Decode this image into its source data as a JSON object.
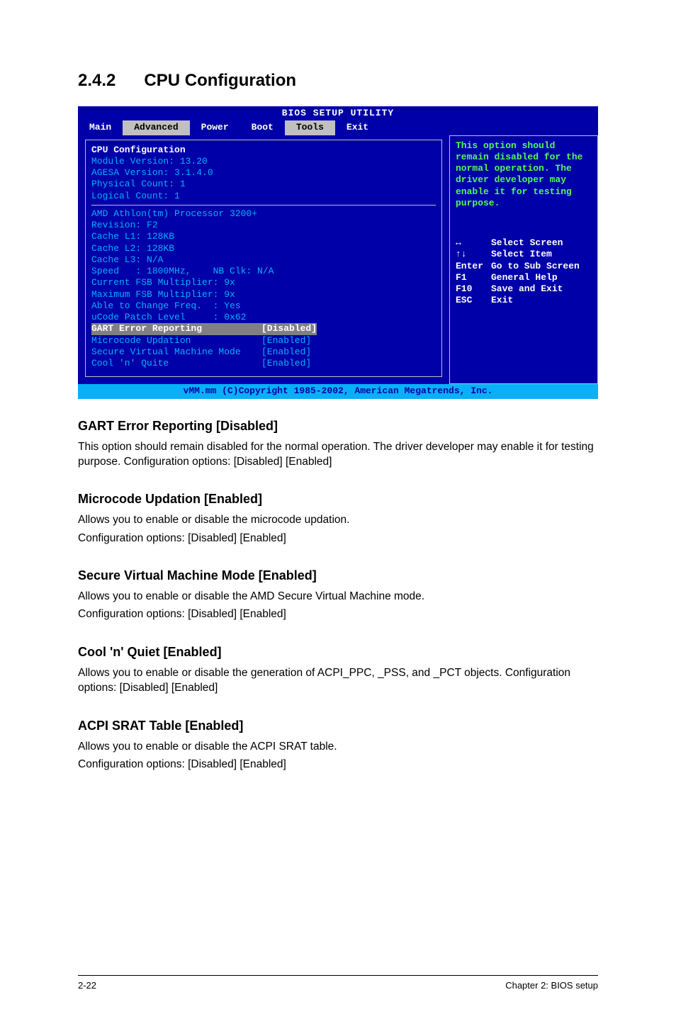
{
  "section": {
    "number": "2.4.2",
    "title": "CPU Configuration"
  },
  "bios": {
    "title": "BIOS SETUP UTILITY",
    "menu": [
      "Main",
      "Advanced",
      "Power",
      "Boot",
      "Tools",
      "Exit"
    ],
    "left": {
      "header": "CPU Configuration",
      "info": [
        "Module Version: 13.20",
        "AGESA Version: 3.1.4.0",
        "Physical Count: 1",
        "Logical Count: 1"
      ],
      "cpu": [
        "AMD Athlon(tm) Processor 3200+",
        "Revision: F2",
        "Cache L1: 128KB",
        "Cache L2: 128KB",
        "Cache L3: N/A",
        "Speed   : 1800MHz,    NB Clk: N/A",
        "Current FSB Multiplier: 9x",
        "Maximum FSB Multiplier: 9x",
        "Able to Change Freq.  : Yes",
        "uCode Patch Level     : 0x62"
      ],
      "opts": {
        "gart": {
          "label": "GART Error Reporting",
          "value": "[Disabled]"
        },
        "micro": {
          "label": "Microcode Updation",
          "value": "[Enabled]"
        },
        "svm": {
          "label": "Secure Virtual Machine Mode",
          "value": "[Enabled]"
        },
        "cool": {
          "label": "Cool 'n' Quite",
          "value": "[Enabled]"
        }
      }
    },
    "right": {
      "help": "This option should remain disabled for the normal operation. The driver developer may enable it for testing purpose.",
      "keys": [
        {
          "k": "↔",
          "d": "Select Screen"
        },
        {
          "k": "↑↓",
          "d": "Select Item"
        },
        {
          "k": "Enter",
          "d": "Go to Sub Screen"
        },
        {
          "k": "F1",
          "d": "General Help"
        },
        {
          "k": "F10",
          "d": "Save and Exit"
        },
        {
          "k": "ESC",
          "d": "Exit"
        }
      ]
    },
    "footer": "vMM.mm (C)Copyright 1985-2002, American Megatrends, Inc."
  },
  "sections": {
    "gart": {
      "h": "GART Error Reporting [Disabled]",
      "p": "This option should remain disabled for the normal operation. The driver developer may enable it for testing purpose. Configuration options: [Disabled] [Enabled]"
    },
    "micro": {
      "h": "Microcode Updation [Enabled]",
      "p1": "Allows you to enable or disable the microcode updation.",
      "p2": "Configuration options: [Disabled] [Enabled]"
    },
    "svm": {
      "h": "Secure Virtual Machine Mode [Enabled]",
      "p1": "Allows you to enable or disable the AMD Secure Virtual Machine mode.",
      "p2": "Configuration options: [Disabled] [Enabled]"
    },
    "cool": {
      "h": "Cool 'n' Quiet [Enabled]",
      "p": "Allows you to enable or disable the generation of ACPI_PPC, _PSS, and _PCT objects. Configuration options: [Disabled] [Enabled]"
    },
    "srat": {
      "h": "ACPI SRAT Table [Enabled]",
      "p1": "Allows you to enable or disable the ACPI SRAT table.",
      "p2": "Configuration options: [Disabled] [Enabled]"
    }
  },
  "footer": {
    "left": "2-22",
    "right": "Chapter 2: BIOS setup"
  }
}
